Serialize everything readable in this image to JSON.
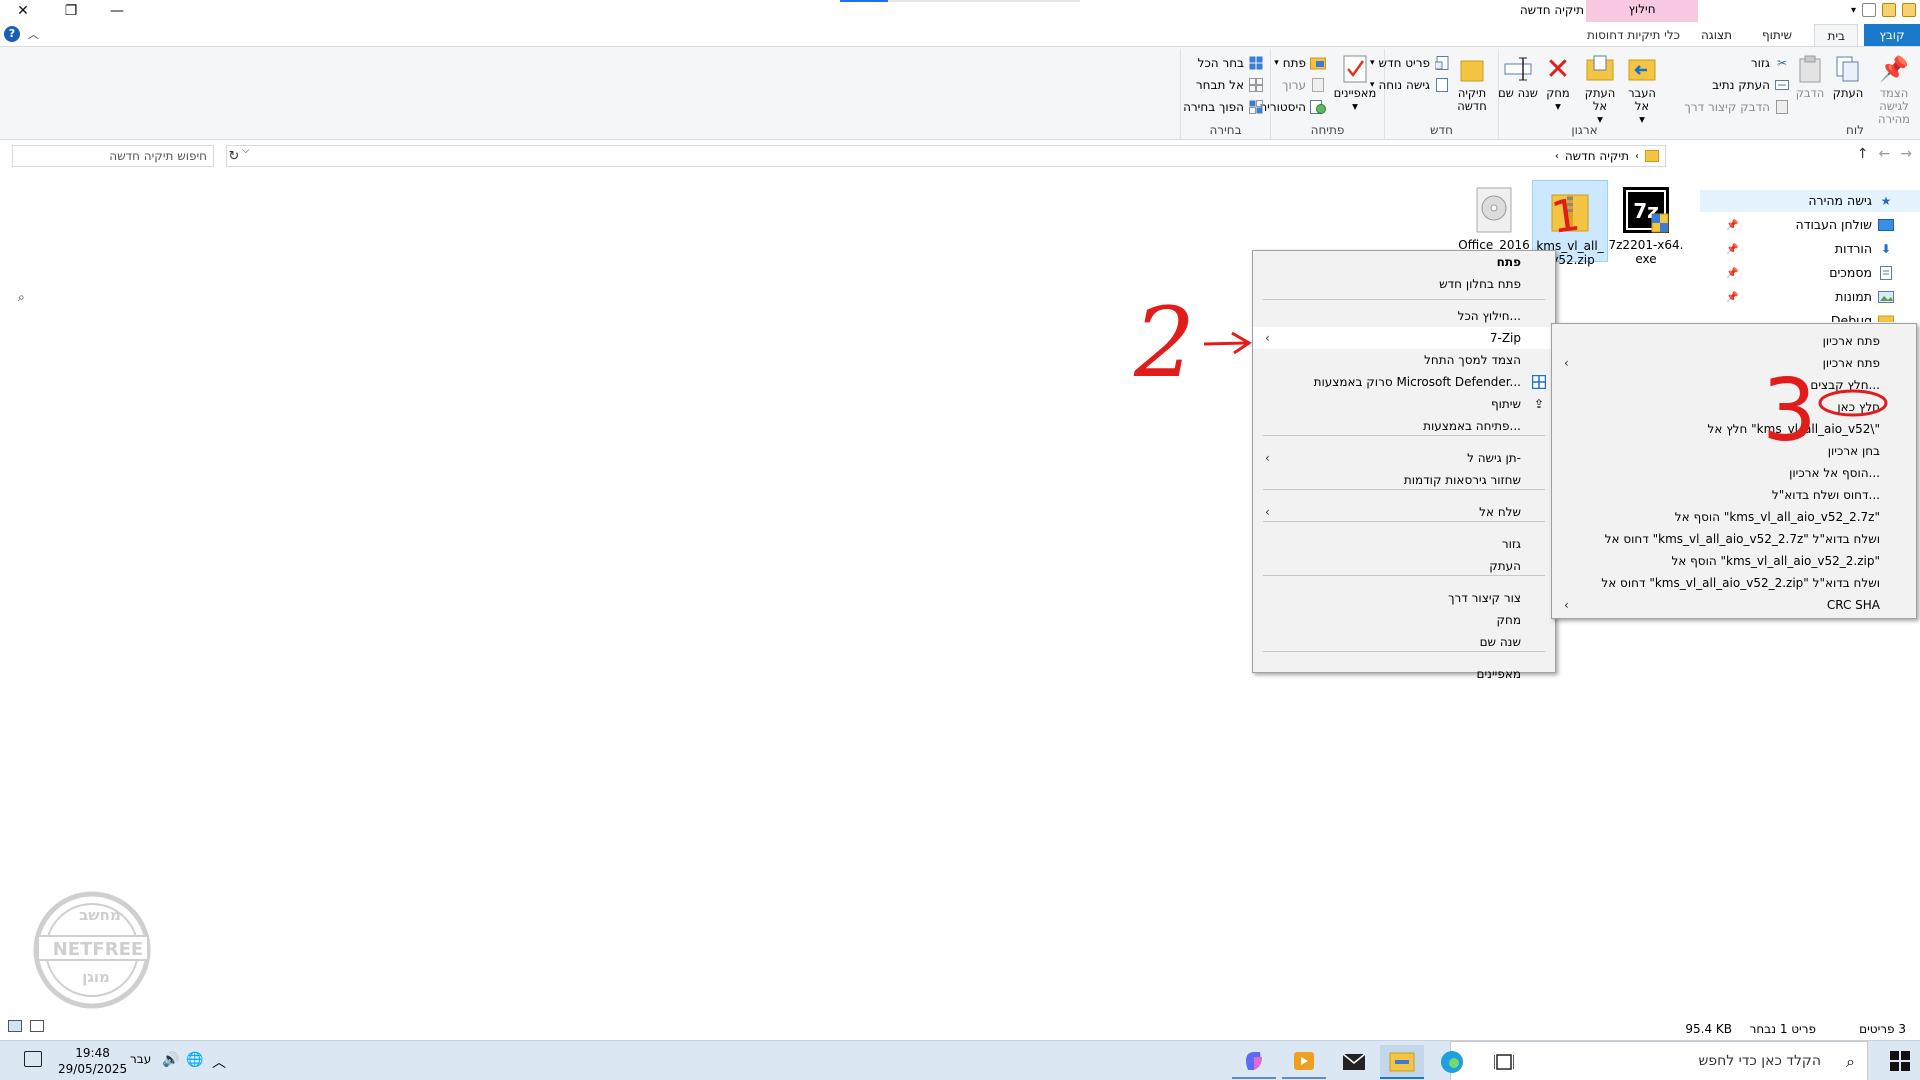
{
  "window": {
    "title": "תיקיה חדשה",
    "context_tab_header": "חילוץ",
    "close_glyph": "✕",
    "maximize_glyph": "❐",
    "minimize_glyph": "—"
  },
  "tabs": [
    {
      "label": "קובץ"
    },
    {
      "label": "בית"
    },
    {
      "label": "שיתוף"
    },
    {
      "label": "תצוגה"
    },
    {
      "label": "כלי תיקיות דחוסות"
    }
  ],
  "ribbon": {
    "clipboard": {
      "label": "לוח",
      "pin_quick": "הצמד לגישה מהירה",
      "copy": "העתק",
      "paste": "הדבק",
      "cut": "גזור",
      "copy_path": "העתק נתיב",
      "paste_shortcut": "הדבק קיצור דרך"
    },
    "organize": {
      "label": "ארגון",
      "move_to": "העבר אל",
      "copy_to": "העתק אל",
      "delete": "מחק",
      "rename": "שנה שם"
    },
    "new": {
      "label": "חדש",
      "new_folder": "תיקיה חדשה",
      "new_item": "פריט חדש",
      "easy_access": "גישה נוחה"
    },
    "open": {
      "label": "פתיחה",
      "properties": "מאפיינים",
      "open": "פתח",
      "edit": "ערוך",
      "history": "היסטוריה"
    },
    "select": {
      "label": "בחירה",
      "select_all": "בחר הכל",
      "select_none": "אל תבחר",
      "invert": "הפוך בחירה"
    }
  },
  "address": {
    "path": "תיקיה חדשה",
    "search_placeholder": "חיפוש תיקיה חדשה"
  },
  "navpane": {
    "quick_access": "גישה מהירה",
    "items": [
      {
        "label": "שולחן העבודה"
      },
      {
        "label": "הורדות"
      },
      {
        "label": "מסמכים"
      },
      {
        "label": "תמונות"
      },
      {
        "label": "Debug"
      }
    ]
  },
  "files": [
    {
      "name": "7z2201-x64.exe",
      "line1": "7z2201-x64.",
      "line2": "exe"
    },
    {
      "name": "kms_vl_all_aio_v52.zip",
      "line1": "kms_vl_all_",
      "line2": "_v52.zip"
    },
    {
      "name": "Office_2016",
      "line1": "Office_2016",
      "line2": ""
    }
  ],
  "context_menu": [
    {
      "label": "פתח",
      "bold": true
    },
    {
      "label": "פתח בחלון חדש"
    },
    {
      "label": "חילוץ הכל..."
    },
    {
      "label": "7-Zip"
    },
    {
      "label": "הצמד למסך התחל"
    },
    {
      "label": "סרוק באמצעות Microsoft Defender..."
    },
    {
      "label": "שיתוף"
    },
    {
      "label": "פתיחה באמצעות..."
    },
    {
      "label": "תן גישה ל-"
    },
    {
      "label": "שחזור גירסאות קודמות"
    },
    {
      "label": "שלח אל"
    },
    {
      "label": "גזור"
    },
    {
      "label": "העתק"
    },
    {
      "label": "צור קיצור דרך"
    },
    {
      "label": "מחק"
    },
    {
      "label": "שנה שם"
    },
    {
      "label": "מאפיינים"
    }
  ],
  "submenu_7zip": [
    {
      "label": "פתח ארכיון"
    },
    {
      "label": "פתח ארכיון"
    },
    {
      "label": "חלץ קבצים..."
    },
    {
      "label": "חלץ כאן"
    },
    {
      "label": "חלץ אל \"kms_vl_all_aio_v52\\\""
    },
    {
      "label": "בחן ארכיון"
    },
    {
      "label": "הוסף אל ארכיון..."
    },
    {
      "label": "דחוס ושלח בדוא\"ל..."
    },
    {
      "label": "הוסף אל \"kms_vl_all_aio_v52_2.7z\""
    },
    {
      "label": "דחוס אל \"kms_vl_all_aio_v52_2.7z\" ושלח בדוא\"ל"
    },
    {
      "label": "הוסף אל \"kms_vl_all_aio_v52_2.zip\""
    },
    {
      "label": "דחוס אל \"kms_vl_all_aio_v52_2.zip\" ושלח בדוא\"ל"
    },
    {
      "label": "CRC SHA"
    }
  ],
  "status": {
    "items": "3 פריטים",
    "selected": "פריט 1 נבחר",
    "size": "95.4 KB"
  },
  "taskbar": {
    "search_placeholder": "הקלד כאן כדי לחפש",
    "time": "19:48",
    "date": "29/05/2025",
    "language": "עבר"
  },
  "annotations": {
    "n1": "1",
    "n2": "2",
    "n3": "3",
    "color": "#e21b1b"
  },
  "watermark": {
    "top": "מחשב",
    "middle": "NETFREE",
    "bottom": "מוגן"
  },
  "colors": {
    "file_tab": "#1979ca",
    "context_tab": "#f8c9e0",
    "selection": "#cce8ff",
    "taskbar": "#dbe8f3"
  }
}
